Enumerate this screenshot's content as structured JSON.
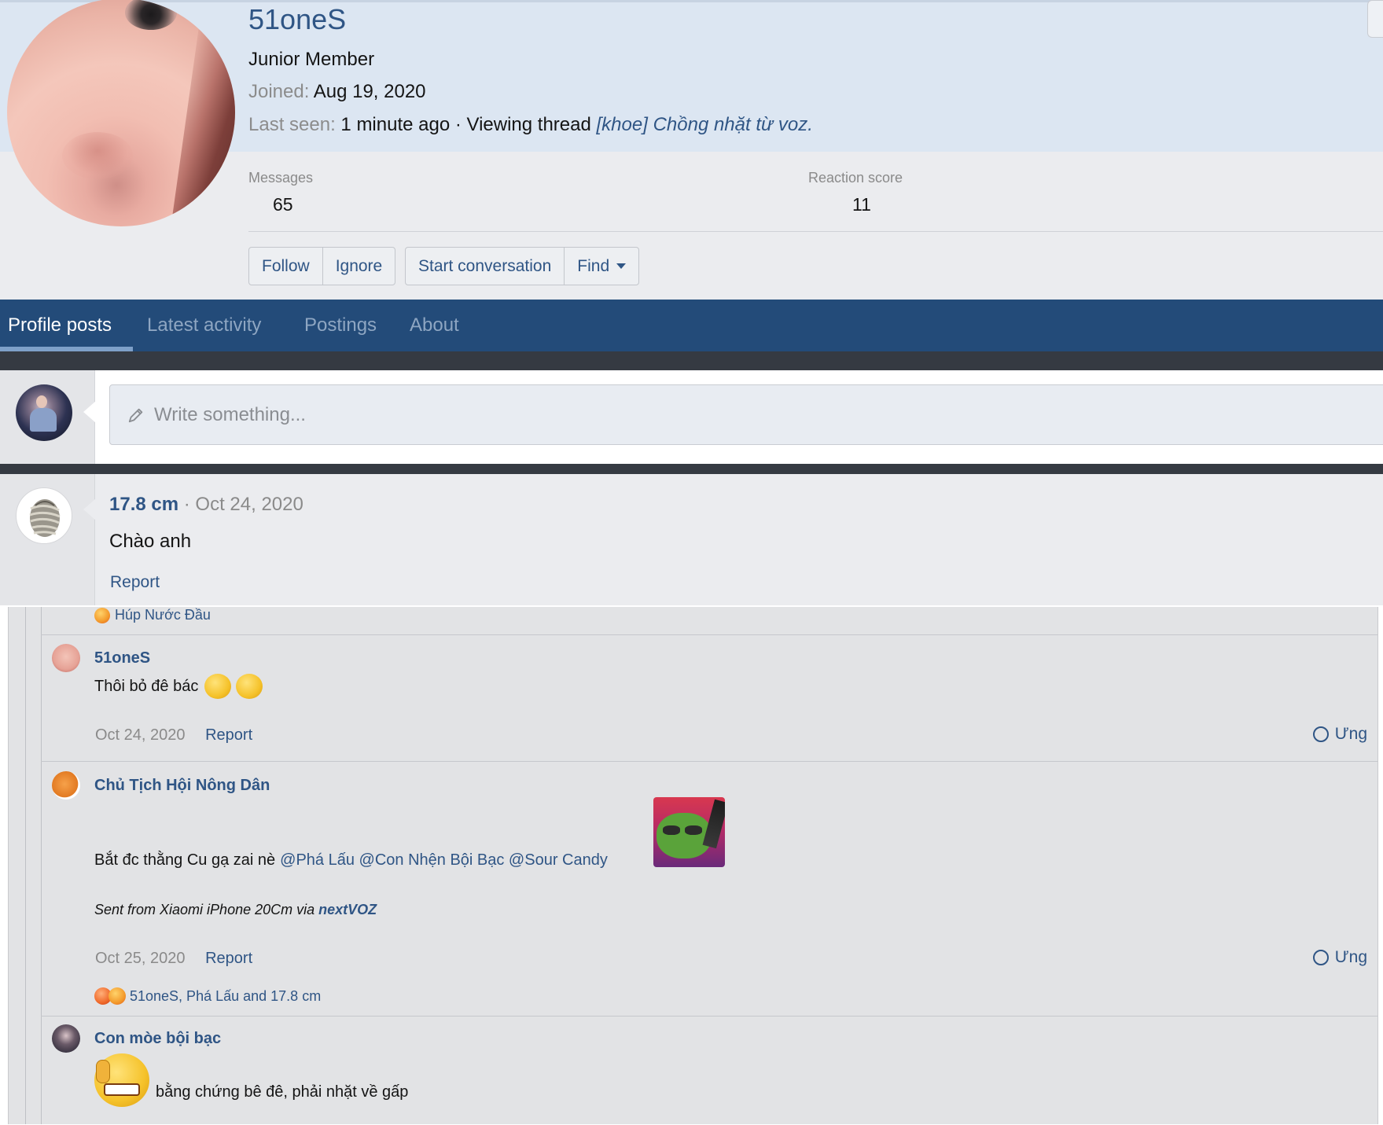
{
  "profile": {
    "username": "51oneS",
    "title": "Junior Member",
    "joined_label": "Joined:",
    "joined_value": "Aug 19, 2020",
    "lastseen_label": "Last seen:",
    "lastseen_value": "1 minute ago · Viewing thread",
    "lastseen_thread": "[khoe] Chồng nhặt từ voz.",
    "messages_label": "Messages",
    "messages_value": "65",
    "reaction_label": "Reaction score",
    "reaction_value": "11"
  },
  "actions": {
    "follow": "Follow",
    "ignore": "Ignore",
    "start_conversation": "Start conversation",
    "find": "Find"
  },
  "tabs": [
    {
      "label": "Profile posts",
      "active": true
    },
    {
      "label": "Latest activity",
      "active": false
    },
    {
      "label": "Postings",
      "active": false
    },
    {
      "label": "About",
      "active": false
    }
  ],
  "composer": {
    "placeholder": "Write something..."
  },
  "profile_post": {
    "author": "17.8 cm",
    "date": "· Oct 24, 2020",
    "body": "Chào anh",
    "report": "Report"
  },
  "thread": {
    "top_reactor": "Húp Nước Đầu",
    "messages": [
      {
        "author": "51oneS",
        "text": "Thôi bỏ đê bác",
        "date": "Oct 24, 2020",
        "report": "Report",
        "react": "Ưng"
      },
      {
        "author": "Chủ Tịch Hội Nông Dân",
        "text": "Bắt đc thằng Cu gạ zai nè",
        "mentions": "@Phá Lấu @Con Nhện Bội Bạc @Sour Candy",
        "sent_prefix": "Sent from Xiaomi iPhone 20Cm via",
        "sent_app": "nextVOZ",
        "date": "Oct 25, 2020",
        "report": "Report",
        "react": "Ưng",
        "reactors": "51oneS, Phá Lấu and 17.8 cm"
      },
      {
        "author": "Con mòe bội bạc",
        "text": "bằng chứng bê đê, phải nhặt về gấp"
      }
    ]
  },
  "colors": {
    "link": "#2f5585",
    "tabbar": "#234b79",
    "header_bg": "#dce6f2",
    "panel_bg": "#ebecef"
  }
}
